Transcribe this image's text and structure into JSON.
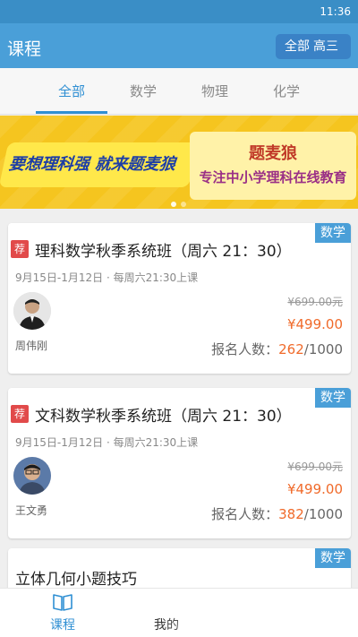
{
  "status_bar": {
    "time": "11:36"
  },
  "app_bar": {
    "title": "课程",
    "filter_scope": "全部",
    "filter_grade": "高三"
  },
  "tabs": [
    {
      "label": "全部"
    },
    {
      "label": "数学"
    },
    {
      "label": "物理"
    },
    {
      "label": "化学"
    }
  ],
  "banner": {
    "slogan": "要想理科强 就来题麦狼",
    "brand": "题麦狼",
    "tagline": "专注中小学理科在线教育"
  },
  "courses": [
    {
      "subject": "数学",
      "badge": "荐",
      "title": "理科数学秋季系统班（周六 21：30）",
      "schedule": "9月15日-1月12日 · 每周六21:30上课",
      "teacher": "周伟刚",
      "original_price": "¥699.00元",
      "price": "¥499.00",
      "enroll_label": "报名人数：",
      "enrolled": "262",
      "capacity": "/1000"
    },
    {
      "subject": "数学",
      "badge": "荐",
      "title": "文科数学秋季系统班（周六 21：30）",
      "schedule": "9月15日-1月12日 · 每周六21:30上课",
      "teacher": "王文勇",
      "original_price": "¥699.00元",
      "price": "¥499.00",
      "enroll_label": "报名人数：",
      "enrolled": "382",
      "capacity": "/1000"
    },
    {
      "subject": "数学",
      "title": "立体几何小题技巧"
    }
  ],
  "bottom_nav": [
    {
      "label": "课程",
      "icon": "book-icon"
    },
    {
      "label": "我的",
      "icon": "user-icon"
    }
  ],
  "colors": {
    "primary": "#4a9fd8",
    "accent_price": "#f06a2a",
    "badge_red": "#e14a4a"
  }
}
